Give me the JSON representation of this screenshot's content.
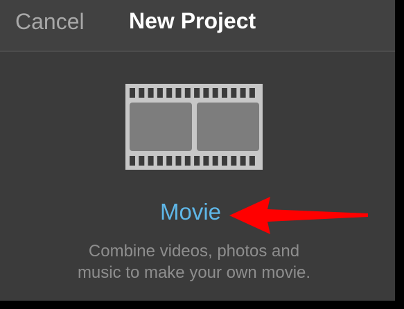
{
  "header": {
    "cancel_label": "Cancel",
    "title": "New Project"
  },
  "project_option": {
    "icon": "film-strip-icon",
    "label": "Movie",
    "description_lines": [
      "Combine videos, photos and",
      "music to make your own movie."
    ]
  },
  "annotation": {
    "icon": "arrow-left-icon",
    "color": "#ff0000"
  },
  "colors": {
    "accent": "#5fb7e8",
    "background": "#3b3b3b",
    "navbar": "#414141"
  }
}
